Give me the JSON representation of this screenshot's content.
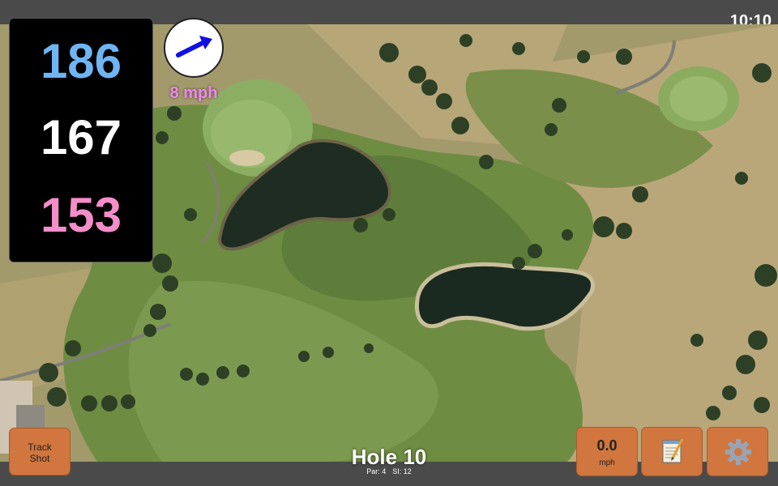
{
  "status": {
    "time": "10:10"
  },
  "distances": {
    "back": "186",
    "middle": "167",
    "front": "153",
    "colors": {
      "back": "#6fb5f3",
      "middle": "#ffffff",
      "front": "#f38ec8"
    }
  },
  "wind": {
    "direction_icon": "wind-direction-arrow-icon",
    "speed_label": "8 mph",
    "arrow_color": "#1010e0"
  },
  "buttons": {
    "track_shot_line1": "Track",
    "track_shot_line2": "Shot",
    "wind_value": "0.0",
    "wind_unit": "mph",
    "notes_icon": "notepad-icon",
    "settings_icon": "gear-icon",
    "color": "#d0763e"
  },
  "hole": {
    "title": "Hole 10",
    "par": "Par: 4",
    "si": "SI: 12"
  }
}
